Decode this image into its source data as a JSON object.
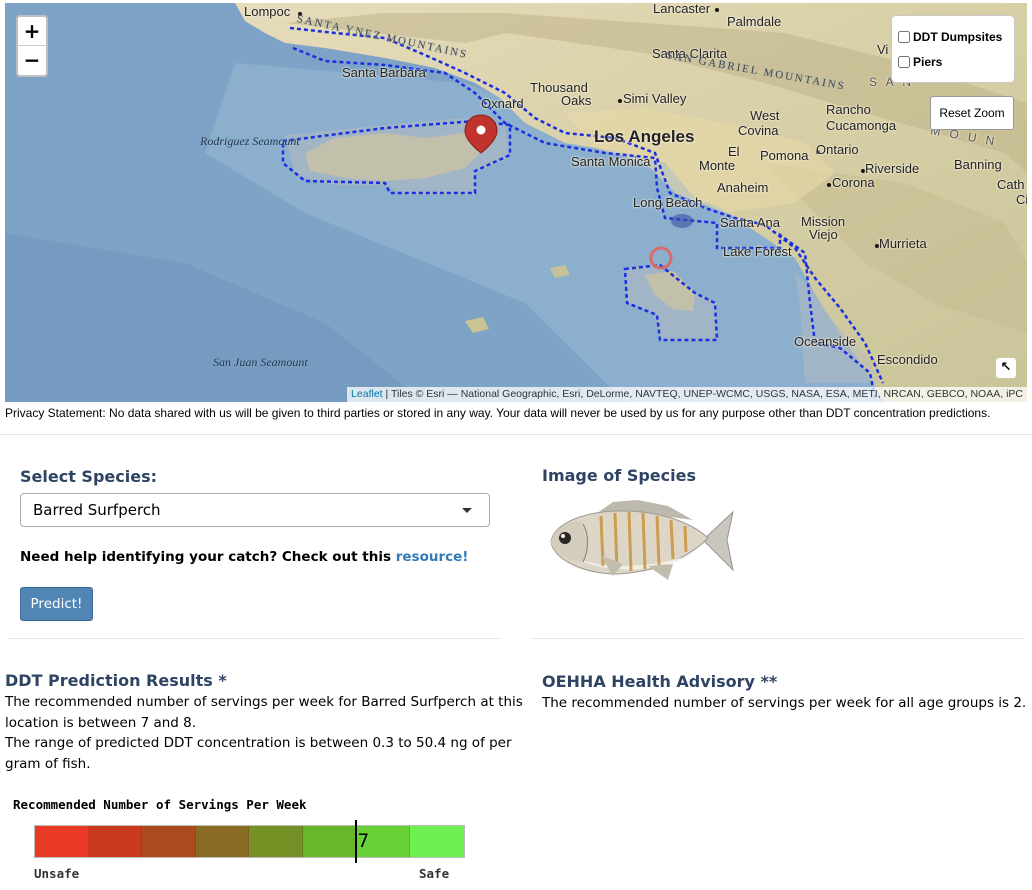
{
  "map": {
    "zoom_in_label": "+",
    "zoom_out_label": "−",
    "layers": [
      {
        "label": "DDT Dumpsites",
        "checked": false
      },
      {
        "label": "Piers",
        "checked": false
      }
    ],
    "reset_zoom_label": "Reset Zoom",
    "expand_label": "↖",
    "attribution": {
      "leaflet": "Leaflet",
      "tiles": " | Tiles © Esri — National Geographic, Esri, DeLorme, NAVTEQ, UNEP-WCMC, USGS, NASA, ESA, METI, NRCAN, GEBCO, NOAA, iPC"
    },
    "places": {
      "lompoc": "Lompoc",
      "lancaster": "Lancaster",
      "palmdale": "Palmdale",
      "santa_ynez": "SANTA YNEZ MOUNTAINS",
      "santa_barbara": "Santa Barbara",
      "santa_clarita": "Santa Clarita",
      "san_gabriel": "SAN GABRIEL MOUNTAINS",
      "thousand_oaks_1": "Thousand",
      "thousand_oaks_2": "Oaks",
      "simi_valley": "Simi Valley",
      "oxnard": "Oxnard",
      "los_angeles": "Los Angeles",
      "west_covina_1": "West",
      "west_covina_2": "Covina",
      "rancho_1": "Rancho",
      "rancho_2": "Cucamonga",
      "santa_monica": "Santa Monica",
      "el_monte_1": "El",
      "el_monte_2": "Monte",
      "pomona": "Pomona",
      "ontario": "Ontario",
      "riverside": "Riverside",
      "banning": "Banning",
      "corona": "Corona",
      "anaheim": "Anaheim",
      "long_beach": "Long Beach",
      "santa_ana": "Santa Ana",
      "mission_viejo_1": "Mission",
      "mission_viejo_2": "Viejo",
      "lake_forest": "Lake Forest",
      "murrieta": "Murrieta",
      "oceanside": "Oceanside",
      "escondido": "Escondido",
      "rodriguez": "Rodriguez Seamount",
      "san_juan": "San Juan Seamount",
      "vi": "Vi",
      "cath_1": "Cath",
      "cath_2": "Ci",
      "san_m": "S A N",
      "moun": "M O U N"
    }
  },
  "privacy": "Privacy Statement: No data shared with us will be given to third parties or stored in any way. Your data will never be used by us for any purpose other than DDT concentration predictions.",
  "species": {
    "heading": "Select Species:",
    "selected": "Barred Surfperch",
    "help_text": "Need help identifying your catch? Check out this ",
    "help_link": "resource!",
    "predict_label": "Predict!"
  },
  "image": {
    "heading": "Image of Species"
  },
  "results": {
    "heading": "DDT Prediction Results *",
    "line1": "The recommended number of servings per week for Barred Surfperch at this",
    "line2": "location is between 7 and 8.",
    "line3": "The range of predicted DDT concentration is between 0.3 to 50.4 ng of per",
    "line4": "gram of fish."
  },
  "advisory": {
    "heading": "OEHHA Health Advisory **",
    "text": "The recommended number of servings per week for all age groups is 2."
  },
  "gauge": {
    "title": "Recommended Number of Servings Per Week",
    "value": 7,
    "value_label": "7",
    "segments": 8,
    "colors": [
      "#e83a24",
      "#c9391e",
      "#ab4a1e",
      "#8a6b24",
      "#759024",
      "#67b62c",
      "#69d138",
      "#6ef050"
    ],
    "low_label": "Unsafe",
    "high_label": "Safe"
  }
}
